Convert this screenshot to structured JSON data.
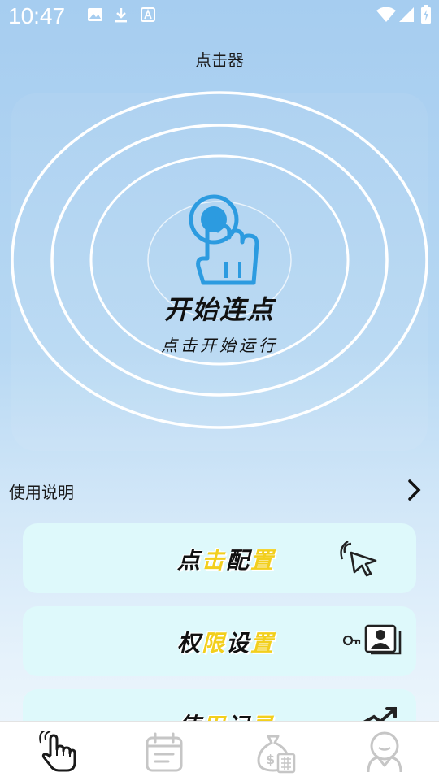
{
  "status_bar": {
    "time": "10:47",
    "left_icons": [
      "image-icon",
      "download-icon",
      "text-icon"
    ],
    "right_icons": [
      "wifi-icon",
      "signal-icon",
      "battery-icon"
    ]
  },
  "app": {
    "title": "点击器"
  },
  "start": {
    "title": "开始连点",
    "subtitle": "点击开始运行",
    "icon": "hand-tap-icon",
    "accent": "#2c9be0"
  },
  "instructions": {
    "label": "使用说明",
    "icon": "chevron-right-icon"
  },
  "cards": [
    {
      "label_parts": [
        "点",
        "击",
        "配",
        "置"
      ],
      "highlight": [
        1,
        3
      ],
      "icon": "cursor-click-icon"
    },
    {
      "label_parts": [
        "权",
        "限",
        "设",
        "置"
      ],
      "highlight": [
        1,
        3
      ],
      "icon": "key-contact-icon"
    },
    {
      "label_parts": [
        "使",
        "用",
        "记",
        "录"
      ],
      "highlight": [
        1,
        3
      ],
      "icon": "trend-arrow-icon"
    }
  ],
  "bottom_nav": [
    {
      "icon": "hand-tap-icon",
      "active": true
    },
    {
      "icon": "calendar-icon",
      "active": false
    },
    {
      "icon": "money-bag-icon",
      "active": false
    },
    {
      "icon": "user-icon",
      "active": false
    }
  ],
  "colors": {
    "highlight": "#f2cf1d",
    "card_bg": "#def9fb",
    "nav_inactive": "#c6c6c6"
  }
}
